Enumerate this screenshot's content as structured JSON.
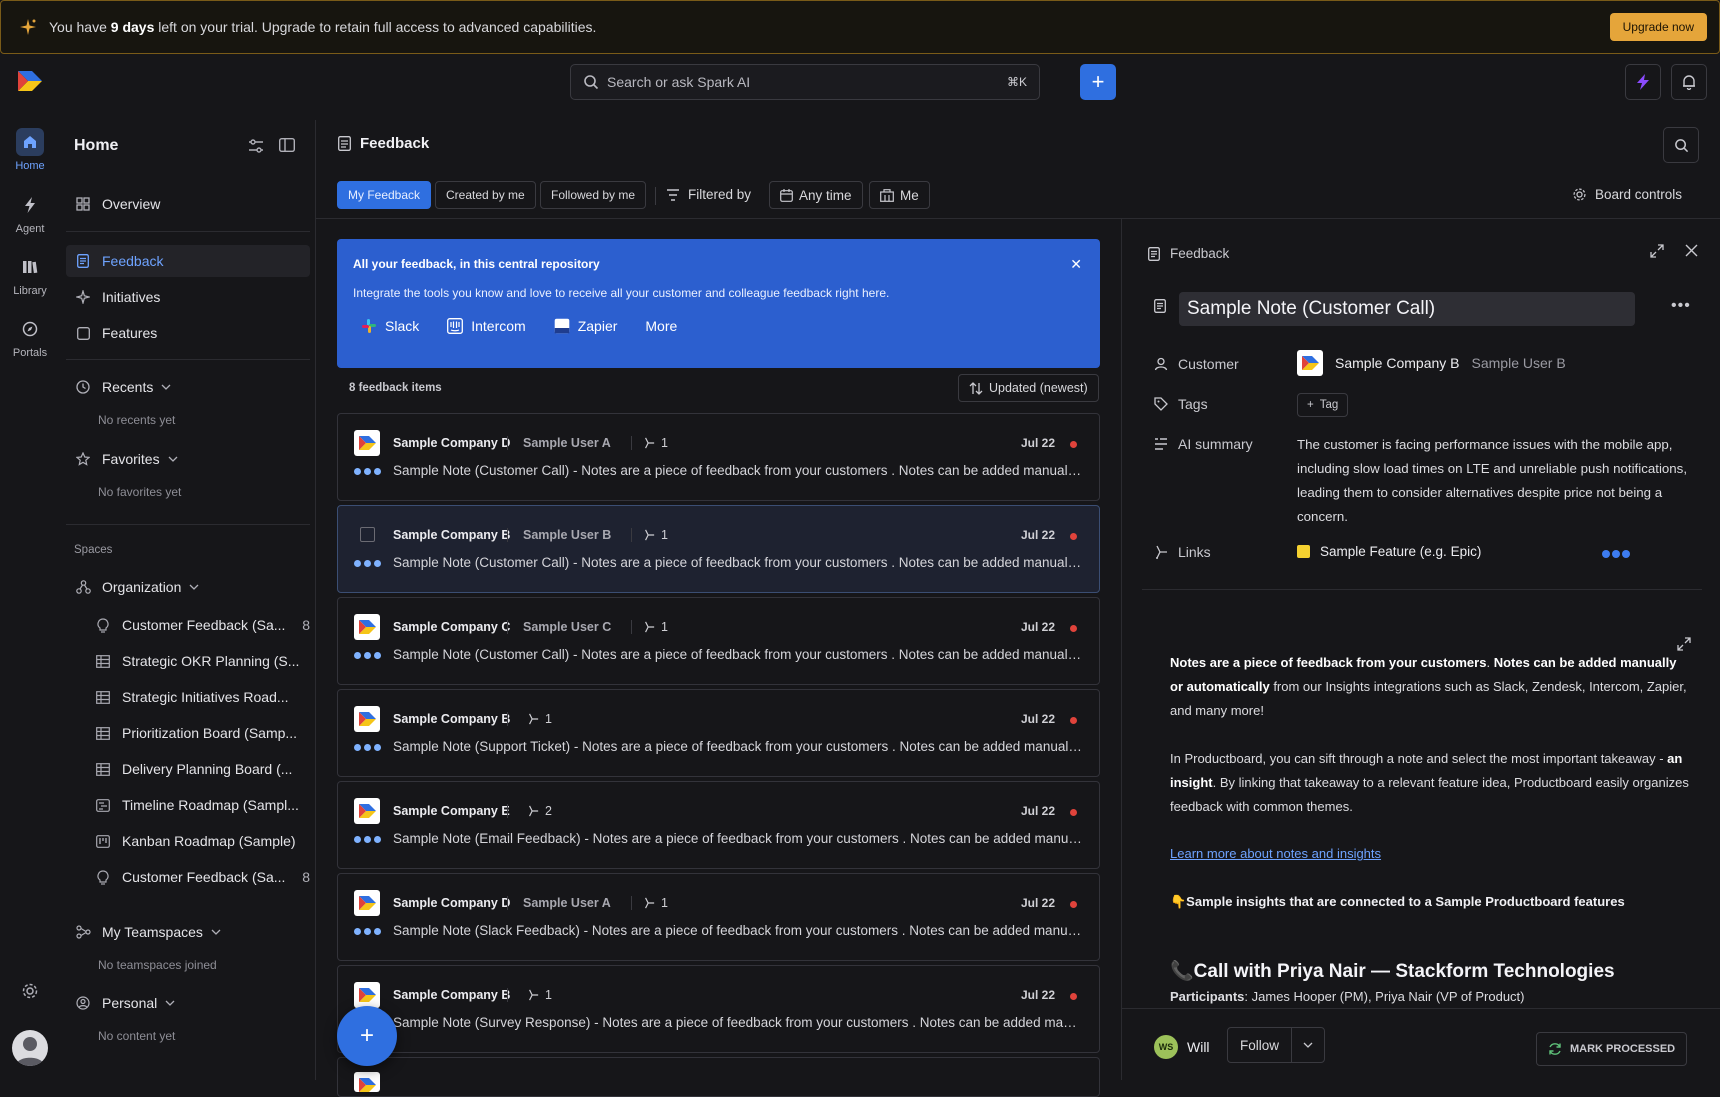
{
  "trial": {
    "prefix": "You have ",
    "days": "9 days",
    "suffix": " left on your trial. Upgrade to retain full access to advanced capabilities.",
    "upgrade_label": "Upgrade now"
  },
  "topbar": {
    "search_placeholder": "Search or ask Spark AI",
    "search_shortcut": "⌘K",
    "add_label": "+"
  },
  "rail": {
    "items": [
      {
        "label": "Home"
      },
      {
        "label": "Agent"
      },
      {
        "label": "Library"
      },
      {
        "label": "Portals"
      }
    ]
  },
  "sidebar": {
    "title": "Home",
    "overview": "Overview",
    "nav": [
      {
        "label": "Feedback"
      },
      {
        "label": "Initiatives"
      },
      {
        "label": "Features"
      }
    ],
    "recents": {
      "label": "Recents",
      "empty": "No recents yet"
    },
    "favorites": {
      "label": "Favorites",
      "empty": "No favorites yet"
    },
    "spaces_label": "Spaces",
    "organization": "Organization",
    "spaces": [
      {
        "label": "Customer Feedback (Sa...",
        "count": "8"
      },
      {
        "label": "Strategic OKR Planning (S..."
      },
      {
        "label": "Strategic Initiatives Road..."
      },
      {
        "label": "Prioritization Board (Samp..."
      },
      {
        "label": "Delivery Planning Board (..."
      },
      {
        "label": "Timeline Roadmap (Sampl..."
      },
      {
        "label": "Kanban Roadmap (Sample)"
      },
      {
        "label": "Customer Feedback (Sa...",
        "count": "8"
      }
    ],
    "teamspaces": {
      "label": "My Teamspaces",
      "empty": "No teamspaces joined"
    },
    "personal": {
      "label": "Personal",
      "empty": "No content yet"
    }
  },
  "main": {
    "title": "Feedback",
    "chips": {
      "my_feedback": "My Feedback",
      "created_by_me": "Created by me",
      "followed_by_me": "Followed by me",
      "filtered_by": "Filtered by",
      "any_time": "Any time",
      "me": "Me"
    },
    "board_controls": "Board controls",
    "info": {
      "title": "All your feedback, in this central repository",
      "subtitle": "Integrate the tools you know and love to receive all your customer and colleague feedback right here.",
      "integrations": [
        "Slack",
        "Intercom",
        "Zapier",
        "More"
      ]
    },
    "count_label": "8 feedback items",
    "sort_label": "Updated (newest)",
    "items": [
      {
        "company": "Sample Company D",
        "user": "Sample User A",
        "links": "1",
        "date": "Jul 22",
        "text": "Sample Note (Customer Call) - Notes are a piece of feedback from your customers . Notes can be added manually or automatically"
      },
      {
        "company": "Sample Company B",
        "user": "Sample User B",
        "links": "1",
        "date": "Jul 22",
        "text": "Sample Note (Customer Call) - Notes are a piece of feedback from your customers . Notes can be added manually or automatically"
      },
      {
        "company": "Sample Company C",
        "user": "Sample User C",
        "links": "1",
        "date": "Jul 22",
        "text": "Sample Note (Customer Call) - Notes are a piece of feedback from your customers . Notes can be added manually or automatically"
      },
      {
        "company": "Sample Company B",
        "user": "",
        "links": "1",
        "date": "Jul 22",
        "text": "Sample Note (Support Ticket) - Notes are a piece of feedback from your customers . Notes can be added manually or automatically"
      },
      {
        "company": "Sample Company E",
        "user": "",
        "links": "2",
        "date": "Jul 22",
        "text": "Sample Note (Email Feedback) - Notes are a piece of feedback from your customers . Notes can be added manually or automatically"
      },
      {
        "company": "Sample Company D",
        "user": "Sample User A",
        "links": "1",
        "date": "Jul 22",
        "text": "Sample Note (Slack Feedback) - Notes are a piece of feedback from your customers . Notes can be added manually or automatically"
      },
      {
        "company": "Sample Company B",
        "user": "",
        "links": "1",
        "date": "Jul 22",
        "text": "Sample Note (Survey Response) - Notes are a piece of feedback from your customers . Notes can be added manually or automatically"
      }
    ],
    "fab_label": "+"
  },
  "panel": {
    "header": "Feedback",
    "title": "Sample Note (Customer Call)",
    "customer_label": "Customer",
    "customer_company": "Sample Company B",
    "customer_user": "Sample User B",
    "tags_label": "Tags",
    "tag_button": "Tag",
    "ai_summary_label": "AI summary",
    "ai_summary": "The customer is facing performance issues with the mobile app, including slow load times on LTE and unreliable push notifications, leading them to consider alternatives despite price not being a concern.",
    "links_label": "Links",
    "link_feature": "Sample Feature (e.g. Epic)",
    "body": {
      "p1_b1": "Notes are a piece of feedback from your customers",
      "p1_t1": ". ",
      "p1_b2": "Notes can be added manually or automatically",
      "p1_t2": " from our Insights integrations such as Slack, Zendesk, Intercom, Zapier, and many more!",
      "p2_t1": "In Productboard, you can sift through a note and select the most important takeaway - ",
      "p2_b1": "an insight",
      "p2_t2": ". By linking that takeaway to a relevant feature idea, Productboard easily organizes feedback with common themes.",
      "link": "Learn more about notes and insights",
      "insights_heading": "👇Sample insights that are connected to a Sample Productboard features",
      "call_heading": "📞Call with Priya Nair — Stackform Technologies",
      "participants_label": "Participants",
      "participants": ": James Hooper (PM), Priya Nair (VP of Product)"
    },
    "footer": {
      "avatar_initials": "WS",
      "user": "Will",
      "follow": "Follow",
      "mark_processed": "MARK PROCESSED"
    }
  },
  "colors": {
    "accent": "#2f6fe0",
    "warning": "#e5a53a",
    "status_dot": "#e0433b",
    "background": "#161619"
  }
}
